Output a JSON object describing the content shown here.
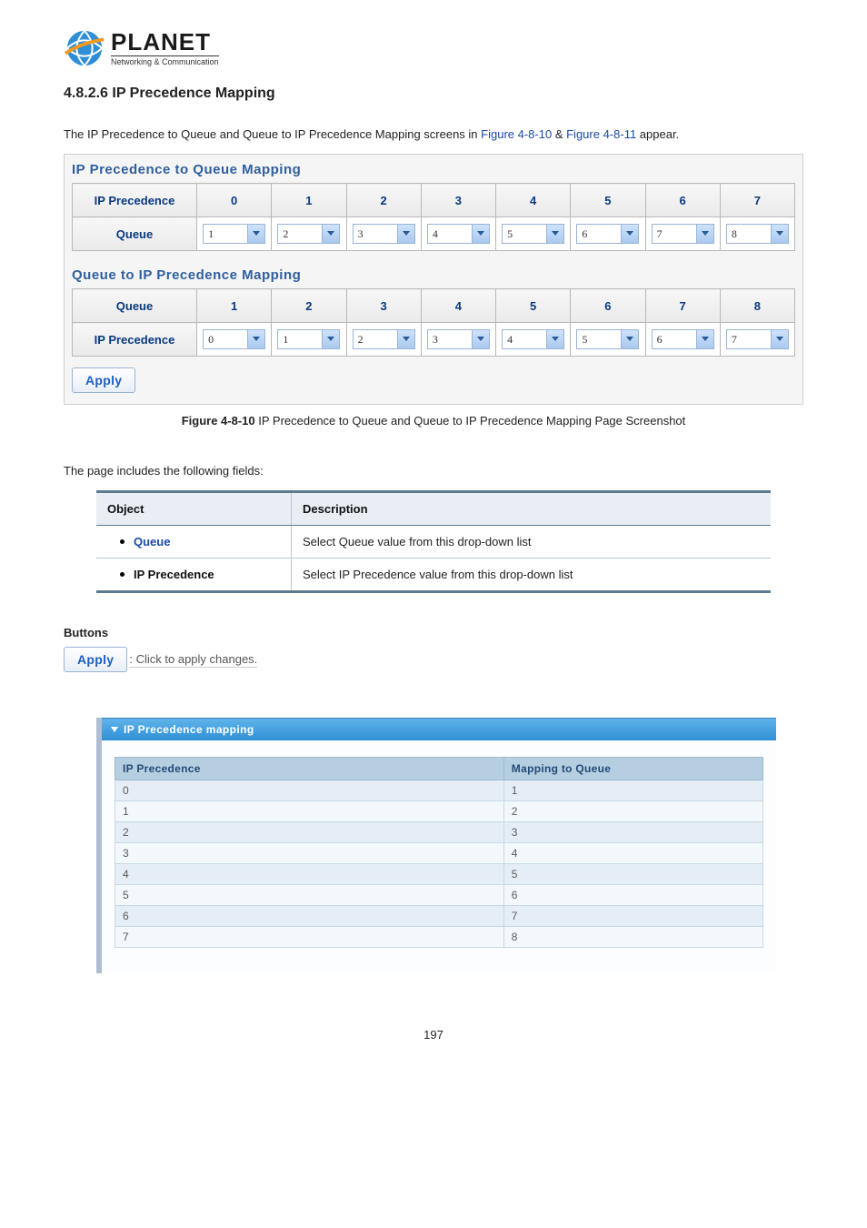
{
  "logo": {
    "brand": "PLANET",
    "tag": "Networking & Communication"
  },
  "heading": "4.8.2.6 IP Precedence Mapping",
  "intro_a": "The IP Precedence to Queue and Queue to IP Precedence Mapping screens in ",
  "intro_link1": "Figure 4-8-10",
  "intro_amp": " & ",
  "intro_link2": "Figure 4-8-11",
  "intro_b": " appear.",
  "panel1": {
    "title1": "IP Precedence to Queue Mapping",
    "row1label": "IP Precedence",
    "row1headers": [
      "0",
      "1",
      "2",
      "3",
      "4",
      "5",
      "6",
      "7"
    ],
    "row2label": "Queue",
    "row2values": [
      "1",
      "2",
      "3",
      "4",
      "5",
      "6",
      "7",
      "8"
    ],
    "title2": "Queue to IP Precedence Mapping",
    "row3label": "Queue",
    "row3headers": [
      "1",
      "2",
      "3",
      "4",
      "5",
      "6",
      "7",
      "8"
    ],
    "row4label": "IP Precedence",
    "row4values": [
      "0",
      "1",
      "2",
      "3",
      "4",
      "5",
      "6",
      "7"
    ],
    "apply": "Apply"
  },
  "caption_bold": "Figure 4-8-10",
  "caption_rest": " IP Precedence to Queue and Queue to IP Precedence Mapping Page Screenshot",
  "fields_intro": "The page includes the following fields:",
  "fields": {
    "h1": "Object",
    "h2": "Description",
    "r1a": "Queue",
    "r1b": "Select Queue value from this drop-down list",
    "r2a": "IP Precedence",
    "r2b": "Select IP Precedence value from this drop-down list"
  },
  "buttons_heading": "Buttons",
  "apply_small": "Apply",
  "apply_desc": ": Click to apply changes.",
  "panel2": {
    "bar": "IP Precedence mapping",
    "h1": "IP Precedence",
    "h2": "Mapping to Queue",
    "chart_data": {
      "type": "table",
      "columns": [
        "IP Precedence",
        "Mapping to Queue"
      ],
      "rows": [
        [
          "0",
          "1"
        ],
        [
          "1",
          "2"
        ],
        [
          "2",
          "3"
        ],
        [
          "3",
          "4"
        ],
        [
          "4",
          "5"
        ],
        [
          "5",
          "6"
        ],
        [
          "6",
          "7"
        ],
        [
          "7",
          "8"
        ]
      ]
    }
  },
  "page_number": "197"
}
